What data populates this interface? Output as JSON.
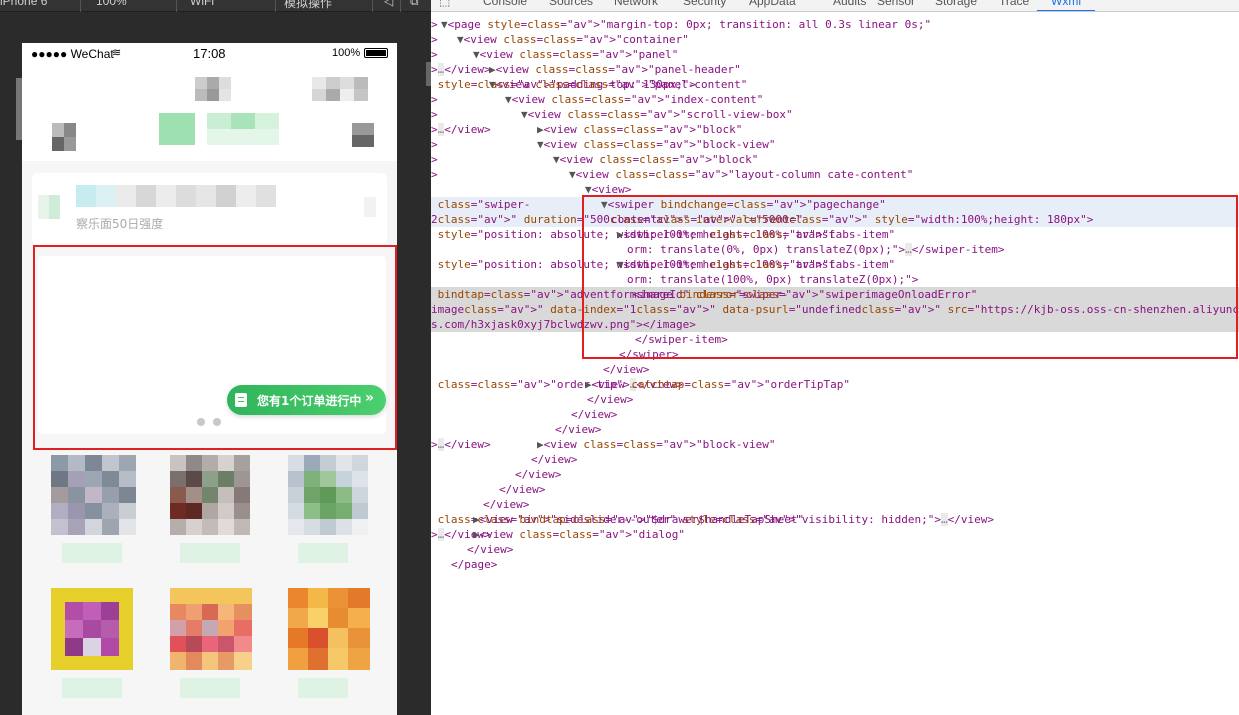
{
  "simulator": {
    "toolbar": [
      "iPhone 6",
      "100%",
      "WiFi",
      "模拟操作"
    ],
    "status_bar": {
      "carrier": "●●●●● WeChat",
      "time": "17:08",
      "battery": "100%"
    },
    "info_card": {
      "subtitle": "察乐面50日强度"
    },
    "order_tip": {
      "label": "您有1个订单进行中"
    },
    "swiper_dots": 2
  },
  "devtools": {
    "tabs": [
      "Console",
      "Sources",
      "Network",
      "Security",
      "AppData",
      "Audits",
      "Sensor",
      "Storage",
      "Trace",
      "Wxml"
    ],
    "active_tab": "Wxml",
    "lines": [
      "<page style=\"margin-top: 0px; transition: all 0.3s linear 0s;\">",
      "<view class=\"container\">",
      "<view class=\"panel\">",
      "<view class=\"panel-header\">…</view>",
      "<view class=\"panel-content\" style=\"padding-top: 130px;\">",
      "<view class=\"index-content\">",
      "<view class=\"scroll-view-box\">",
      "<view class=\"block\">…</view>",
      "<view class=\"block-view\">",
      "<view class=\"block\">",
      "<view class=\"layout-column cate-content\">",
      "<view>",
      "<swiper bindchange=\"pagechange\" class=\"swiper-",
      "content\" current=\"2\" duration=\"500\" interval=\"5000\" style=\"width:100%;height: 180px\">",
      "<swiper-item class=\"tabs-item\" style=\"position: absolute; width: 100%; height: 100%; transf",
      "orm: translate(0%, 0px) translateZ(0px);\">…</swiper-item>",
      "<swiper-item class=\"tabs-item\" style=\"position: absolute; width: 100%; height: 100%; transf",
      "orm: translate(100%, 0px) translateZ(0px);\">",
      "<image binderror=\"swiperimageOnloadError\" bindtap=\"adventformshareId\" class=\"swiper-",
      "image\" data-index=\"1\" data-psurl=\"undefined\" src=\"https://kjb-oss.oss-cn-shenzhen.aliyunc",
      "s.com/h3xjask0xyj7bclwdzwv.png\"></image>",
      "</swiper-item>",
      "</swiper>",
      "</view>",
      "<view catchtap=\"orderTipTap\" class=\"order-tip\">…</view>",
      "</view>",
      "</view>",
      "</view>",
      "<view class=\"block-view\">…</view>",
      "</view>",
      "</view>",
      "</view>",
      "</view>",
      "<view bindtap=\"$drawer$handleTapSheet\" class=\"sideslider--outer\" style=\"visibility: hidden;\">…</view>",
      "<view class=\"dialog\">…</view>",
      "</view>",
      "</page>"
    ]
  },
  "colors": {
    "highlight_border": "#e02020",
    "accent_green": "#3cc064",
    "active_tab": "#1a73e8"
  }
}
